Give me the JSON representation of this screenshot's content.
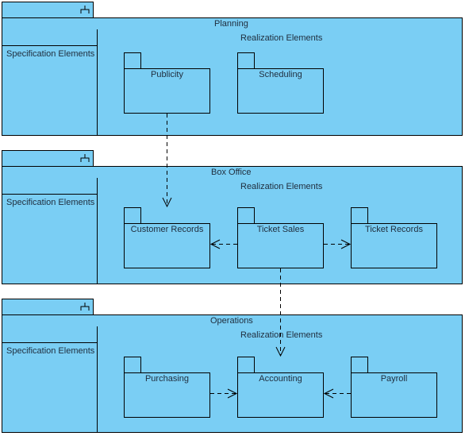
{
  "diagram": {
    "fill_color": "#7acef4",
    "line_color": "#000000",
    "subsystems": [
      {
        "name": "Planning",
        "spec_label": "Specification Elements",
        "realization_label": "Realization Elements",
        "packages": [
          {
            "name": "Publicity"
          },
          {
            "name": "Scheduling"
          }
        ]
      },
      {
        "name": "Box Office",
        "spec_label": "Specification Elements",
        "realization_label": "Realization Elements",
        "packages": [
          {
            "name": "Customer Records"
          },
          {
            "name": "Ticket Sales"
          },
          {
            "name": "Ticket Records"
          }
        ]
      },
      {
        "name": "Operations",
        "spec_label": "Specification Elements",
        "realization_label": "Realization Elements",
        "packages": [
          {
            "name": "Purchasing"
          },
          {
            "name": "Accounting"
          },
          {
            "name": "Payroll"
          }
        ]
      }
    ],
    "dependencies": [
      {
        "from": "Publicity",
        "to": "Customer Records"
      },
      {
        "from": "Ticket Sales",
        "to": "Customer Records"
      },
      {
        "from": "Ticket Sales",
        "to": "Ticket Records"
      },
      {
        "from": "Ticket Sales",
        "to": "Accounting"
      },
      {
        "from": "Purchasing",
        "to": "Accounting"
      },
      {
        "from": "Payroll",
        "to": "Accounting"
      }
    ]
  }
}
